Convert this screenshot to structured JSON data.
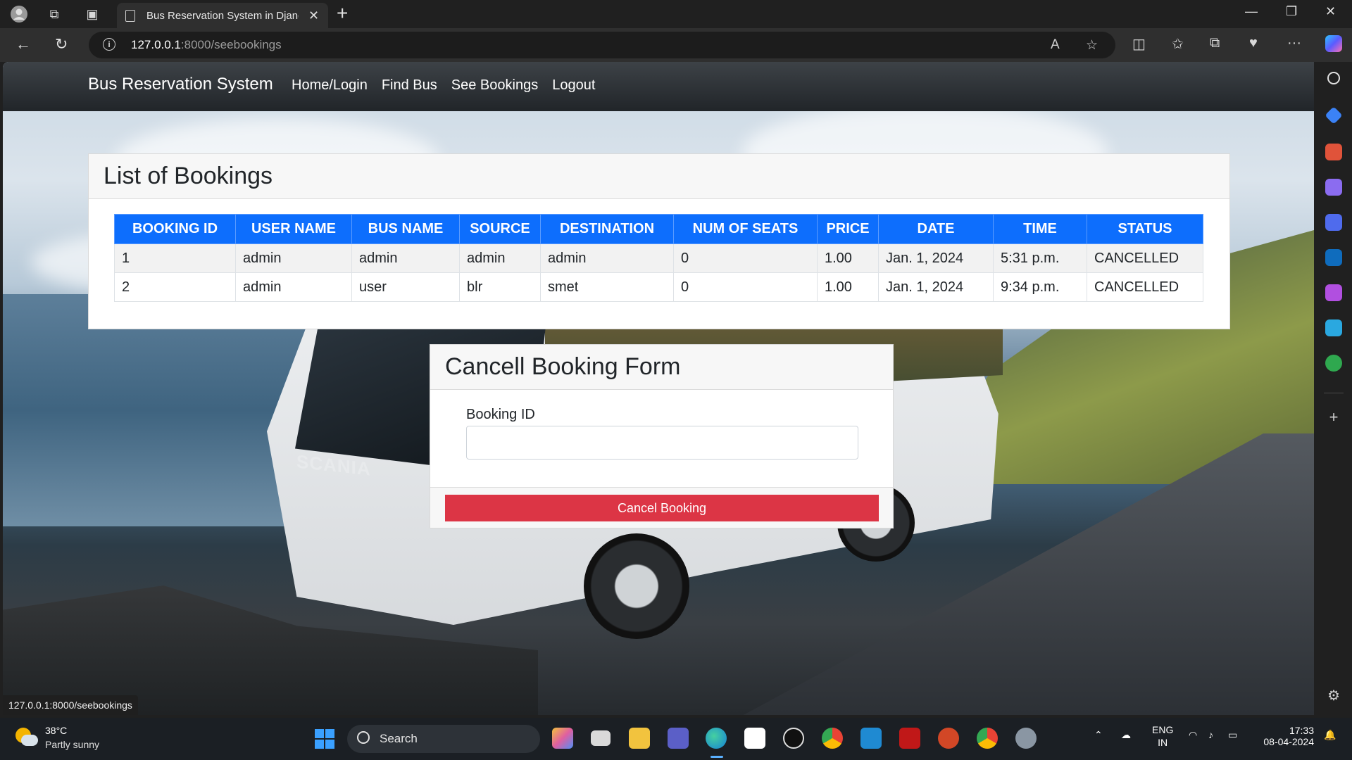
{
  "browser": {
    "tab_title": "Bus Reservation System in Djang",
    "url_host": "127.0.0.1",
    "url_path": ":8000/seebookings",
    "status_url": "127.0.0.1:8000/seebookings"
  },
  "navbar": {
    "brand": "Bus Reservation System",
    "links": [
      "Home/Login",
      "Find Bus",
      "See Bookings",
      "Logout"
    ]
  },
  "bookings": {
    "title": "List of Bookings",
    "columns": [
      "BOOKING ID",
      "USER NAME",
      "BUS NAME",
      "SOURCE",
      "DESTINATION",
      "NUM OF SEATS",
      "PRICE",
      "DATE",
      "TIME",
      "STATUS"
    ],
    "rows": [
      [
        "1",
        "admin",
        "admin",
        "admin",
        "admin",
        "0",
        "1.00",
        "Jan. 1, 2024",
        "5:31 p.m.",
        "CANCELLED"
      ],
      [
        "2",
        "admin",
        "user",
        "blr",
        "smet",
        "0",
        "1.00",
        "Jan. 1, 2024",
        "9:34 p.m.",
        "CANCELLED"
      ]
    ]
  },
  "cancel_form": {
    "title": "Cancell Booking Form",
    "field_label": "Booking ID",
    "field_value": "",
    "submit_label": "Cancel Booking"
  },
  "background": {
    "bus_brand": "SCANIA"
  },
  "taskbar": {
    "temperature": "38°C",
    "condition": "Partly sunny",
    "search_label": "Search",
    "language": "ENG",
    "region": "IN",
    "time": "17:33",
    "date": "08-04-2024"
  },
  "colors": {
    "primary": "#0d6efd",
    "danger": "#dc3545",
    "navbar": "#212529"
  }
}
